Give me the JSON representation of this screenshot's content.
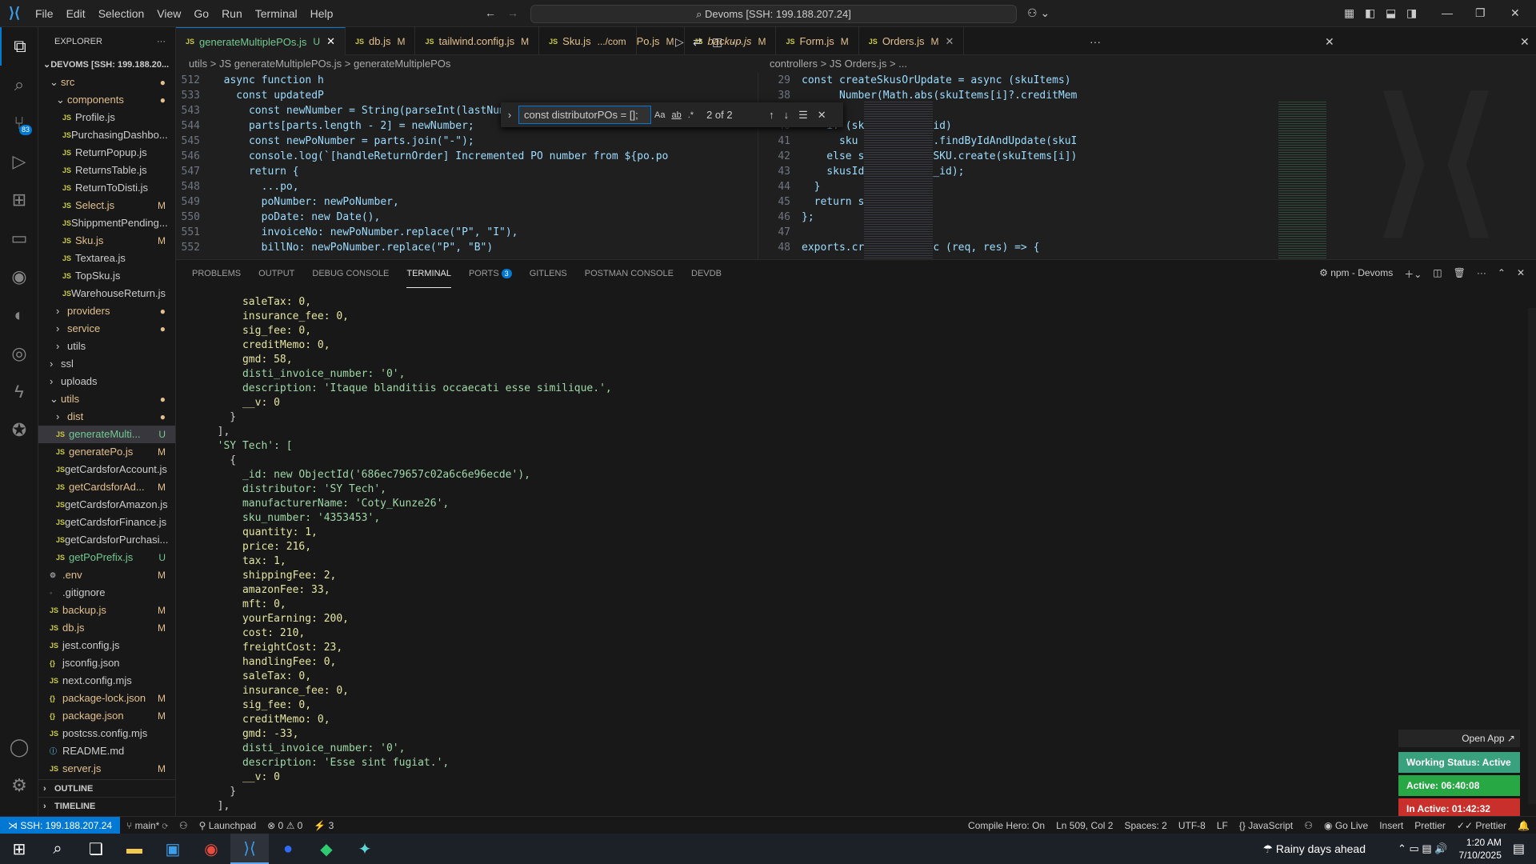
{
  "titlebar": {
    "menus": [
      "File",
      "Edit",
      "Selection",
      "View",
      "Go",
      "Run",
      "Terminal",
      "Help"
    ],
    "command_center": "Devoms [SSH: 199.188.207.24]"
  },
  "sidebar": {
    "title": "EXPLORER",
    "root": "DEVOMS [SSH: 199.188.20...",
    "items": [
      {
        "label": "src",
        "kind": "folder",
        "indent": 1,
        "open": true,
        "badge": "●"
      },
      {
        "label": "components",
        "kind": "folder",
        "indent": 2,
        "open": true,
        "badge": "●"
      },
      {
        "label": "Profile.js",
        "kind": "js",
        "indent": 3,
        "badge": ""
      },
      {
        "label": "PurchasingDashbo...",
        "kind": "js",
        "indent": 3,
        "badge": ""
      },
      {
        "label": "ReturnPopup.js",
        "kind": "js",
        "indent": 3,
        "badge": ""
      },
      {
        "label": "ReturnsTable.js",
        "kind": "js",
        "indent": 3,
        "badge": ""
      },
      {
        "label": "ReturnToDisti.js",
        "kind": "js",
        "indent": 3,
        "badge": ""
      },
      {
        "label": "Select.js",
        "kind": "js",
        "indent": 3,
        "badge": "M"
      },
      {
        "label": "ShippmentPending...",
        "kind": "js",
        "indent": 3,
        "badge": ""
      },
      {
        "label": "Sku.js",
        "kind": "js",
        "indent": 3,
        "badge": "M"
      },
      {
        "label": "Textarea.js",
        "kind": "js",
        "indent": 3,
        "badge": ""
      },
      {
        "label": "TopSku.js",
        "kind": "js",
        "indent": 3,
        "badge": ""
      },
      {
        "label": "WarehouseReturn.js",
        "kind": "js",
        "indent": 3,
        "badge": ""
      },
      {
        "label": "providers",
        "kind": "folder",
        "indent": 2,
        "open": false,
        "badge": "●"
      },
      {
        "label": "service",
        "kind": "folder",
        "indent": 2,
        "open": false,
        "badge": "●"
      },
      {
        "label": "utils",
        "kind": "folder",
        "indent": 2,
        "open": false,
        "badge": ""
      },
      {
        "label": "ssl",
        "kind": "folder",
        "indent": 1,
        "open": false,
        "badge": ""
      },
      {
        "label": "uploads",
        "kind": "folder",
        "indent": 1,
        "open": false,
        "badge": ""
      },
      {
        "label": "utils",
        "kind": "folder",
        "indent": 1,
        "open": true,
        "badge": "●"
      },
      {
        "label": "dist",
        "kind": "folder",
        "indent": 2,
        "open": false,
        "badge": "●"
      },
      {
        "label": "generateMulti...",
        "kind": "js",
        "indent": 2,
        "badge": "U",
        "selected": true
      },
      {
        "label": "generatePo.js",
        "kind": "js",
        "indent": 2,
        "badge": "M"
      },
      {
        "label": "getCardsforAccount.js",
        "kind": "js",
        "indent": 2,
        "badge": ""
      },
      {
        "label": "getCardsforAd...",
        "kind": "js",
        "indent": 2,
        "badge": "M"
      },
      {
        "label": "getCardsforAmazon.js",
        "kind": "js",
        "indent": 2,
        "badge": ""
      },
      {
        "label": "getCardsforFinance.js",
        "kind": "js",
        "indent": 2,
        "badge": ""
      },
      {
        "label": "getCardsforPurchasi...",
        "kind": "js",
        "indent": 2,
        "badge": ""
      },
      {
        "label": "getPoPrefix.js",
        "kind": "js",
        "indent": 2,
        "badge": "U"
      },
      {
        "label": ".env",
        "kind": "gear",
        "indent": 1,
        "badge": "M"
      },
      {
        "label": ".gitignore",
        "kind": "dot",
        "indent": 1,
        "badge": ""
      },
      {
        "label": "backup.js",
        "kind": "js",
        "indent": 1,
        "badge": "M"
      },
      {
        "label": "db.js",
        "kind": "js",
        "indent": 1,
        "badge": "M"
      },
      {
        "label": "jest.config.js",
        "kind": "js",
        "indent": 1,
        "badge": ""
      },
      {
        "label": "jsconfig.json",
        "kind": "json",
        "indent": 1,
        "badge": ""
      },
      {
        "label": "next.config.mjs",
        "kind": "js",
        "indent": 1,
        "badge": ""
      },
      {
        "label": "package-lock.json",
        "kind": "json",
        "indent": 1,
        "badge": "M"
      },
      {
        "label": "package.json",
        "kind": "json",
        "indent": 1,
        "badge": "M"
      },
      {
        "label": "postcss.config.mjs",
        "kind": "js",
        "indent": 1,
        "badge": ""
      },
      {
        "label": "README.md",
        "kind": "info",
        "indent": 1,
        "badge": ""
      },
      {
        "label": "server.js",
        "kind": "js",
        "indent": 1,
        "badge": "M"
      }
    ],
    "outline": "OUTLINE",
    "timeline": "TIMELINE"
  },
  "tabs": [
    {
      "label": "generateMultiplePOs.js",
      "mark": "U",
      "active": true,
      "close": "✕"
    },
    {
      "label": "db.js",
      "mark": "M"
    },
    {
      "label": "tailwind.config.js",
      "mark": "M"
    },
    {
      "label": "Sku.js",
      "mark": ".../com"
    },
    {
      "label": "Po.js",
      "mark": "M"
    },
    {
      "label": "backup.js",
      "mark": "M"
    },
    {
      "label": "Form.js",
      "mark": "M"
    },
    {
      "label": "Orders.js",
      "mark": "M",
      "close": "✕"
    }
  ],
  "left_editor": {
    "breadcrumb": [
      "utils",
      ">",
      "JS generateMultiplePOs.js",
      ">",
      "generateMultiplePOs"
    ],
    "find": {
      "query": "const distributorPOs = [];",
      "count": "2 of 2",
      "opt_case": "Aa",
      "opt_word": "ab",
      "opt_regex": ".*"
    },
    "lines": [
      {
        "n": "512",
        "code": "  async function h"
      },
      {
        "n": "533",
        "code": "    const updatedP"
      },
      {
        "n": "543",
        "code": "      const newNumber = String(parseInt(lastNumberPart) + 1);"
      },
      {
        "n": "544",
        "code": "      parts[parts.length - 2] = newNumber;"
      },
      {
        "n": "545",
        "code": "      const newPoNumber = parts.join(\"-\");"
      },
      {
        "n": "546",
        "code": "      console.log(`[handleReturnOrder] Incremented PO number from ${po.po"
      },
      {
        "n": "547",
        "code": "      return {"
      },
      {
        "n": "548",
        "code": "        ...po,"
      },
      {
        "n": "549",
        "code": "        poNumber: newPoNumber,"
      },
      {
        "n": "550",
        "code": "        poDate: new Date(),"
      },
      {
        "n": "551",
        "code": "        invoiceNo: newPoNumber.replace(\"P\", \"I\"),"
      },
      {
        "n": "552",
        "code": "        billNo: newPoNumber.replace(\"P\", \"B\")"
      }
    ]
  },
  "right_editor": {
    "breadcrumb": [
      "controllers",
      ">",
      "JS Orders.js",
      ">",
      "..."
    ],
    "lines": [
      {
        "n": "29",
        "code": "const createSkusOrUpdate = async (skuItems)"
      },
      {
        "n": "38",
        "code": "      Number(Math.abs(skuItems[i]?.creditMem"
      },
      {
        "n": "39",
        "code": "    );"
      },
      {
        "n": "40",
        "code": "    if (skuItems[i]._id)"
      },
      {
        "n": "41",
        "code": "      sku = await SKU.findByIdAndUpdate(skuI"
      },
      {
        "n": "42",
        "code": "    else sku = await SKU.create(skuItems[i])"
      },
      {
        "n": "43",
        "code": "    skusIds.push(sku._id);"
      },
      {
        "n": "44",
        "code": "  }"
      },
      {
        "n": "45",
        "code": "  return skusIds;"
      },
      {
        "n": "46",
        "code": "};"
      },
      {
        "n": "47",
        "code": ""
      },
      {
        "n": "48",
        "code": "exports.create = async (req, res) => {"
      }
    ]
  },
  "panel": {
    "tabs": [
      "PROBLEMS",
      "OUTPUT",
      "DEBUG CONSOLE",
      "TERMINAL",
      "PORTS",
      "GITLENS",
      "POSTMAN CONSOLE",
      "DEVDB"
    ],
    "ports_badge": "3",
    "terminal_name": "npm - Devoms",
    "terminal_lines": [
      "      saleTax: 0,",
      "      insurance_fee: 0,",
      "      sig_fee: 0,",
      "      creditMemo: 0,",
      "      gmd: 58,",
      "      disti_invoice_number: '0',",
      "      description: 'Itaque blanditiis occaecati esse similique.',",
      "      __v: 0",
      "    }",
      "  ],",
      "  'SY Tech': [",
      "    {",
      "      _id: new ObjectId('686ec79657c02a6c6e96ecde'),",
      "      distributor: 'SY Tech',",
      "      manufacturerName: 'Coty_Kunze26',",
      "      sku_number: '4353453',",
      "      quantity: 1,",
      "      price: 216,",
      "      tax: 1,",
      "      shippingFee: 2,",
      "      amazonFee: 33,",
      "      mft: 0,",
      "      yourEarning: 200,",
      "      cost: 210,",
      "      freightCost: 23,",
      "      handlingFee: 0,",
      "      saleTax: 0,",
      "      insurance_fee: 0,",
      "      sig_fee: 0,",
      "      creditMemo: 0,",
      "      gmd: -33,",
      "      disti_invoice_number: '0',",
      "      description: 'Esse sint fugiat.',",
      "      __v: 0",
      "    }",
      "  ],"
    ]
  },
  "floating": {
    "open_app": "Open App ↗",
    "working": "Working Status: Active",
    "active": "Active: 06:40:08",
    "inactive": "In Active: 01:42:32"
  },
  "statusbar": {
    "remote": "SSH: 199.188.207.24",
    "branch": "main*",
    "launchpad": "Launchpad",
    "problems": "⊗ 0 ⚠ 0",
    "ports": "3",
    "compile": "Compile Hero: On",
    "position": "Ln 509, Col 2",
    "spaces": "Spaces: 2",
    "encoding": "UTF-8",
    "eol": "LF",
    "language": "JavaScript",
    "golive": "Go Live",
    "insert": "Insert",
    "prettier1": "Prettier",
    "prettier2": "Prettier"
  },
  "taskbar": {
    "weather": "Rainy days ahead",
    "time": "1:20 AM",
    "date": "7/10/2025"
  },
  "colors": {
    "accent": "#0078d4",
    "working": "#3aa17e",
    "active": "#28a745",
    "inactive": "#c9302c"
  }
}
